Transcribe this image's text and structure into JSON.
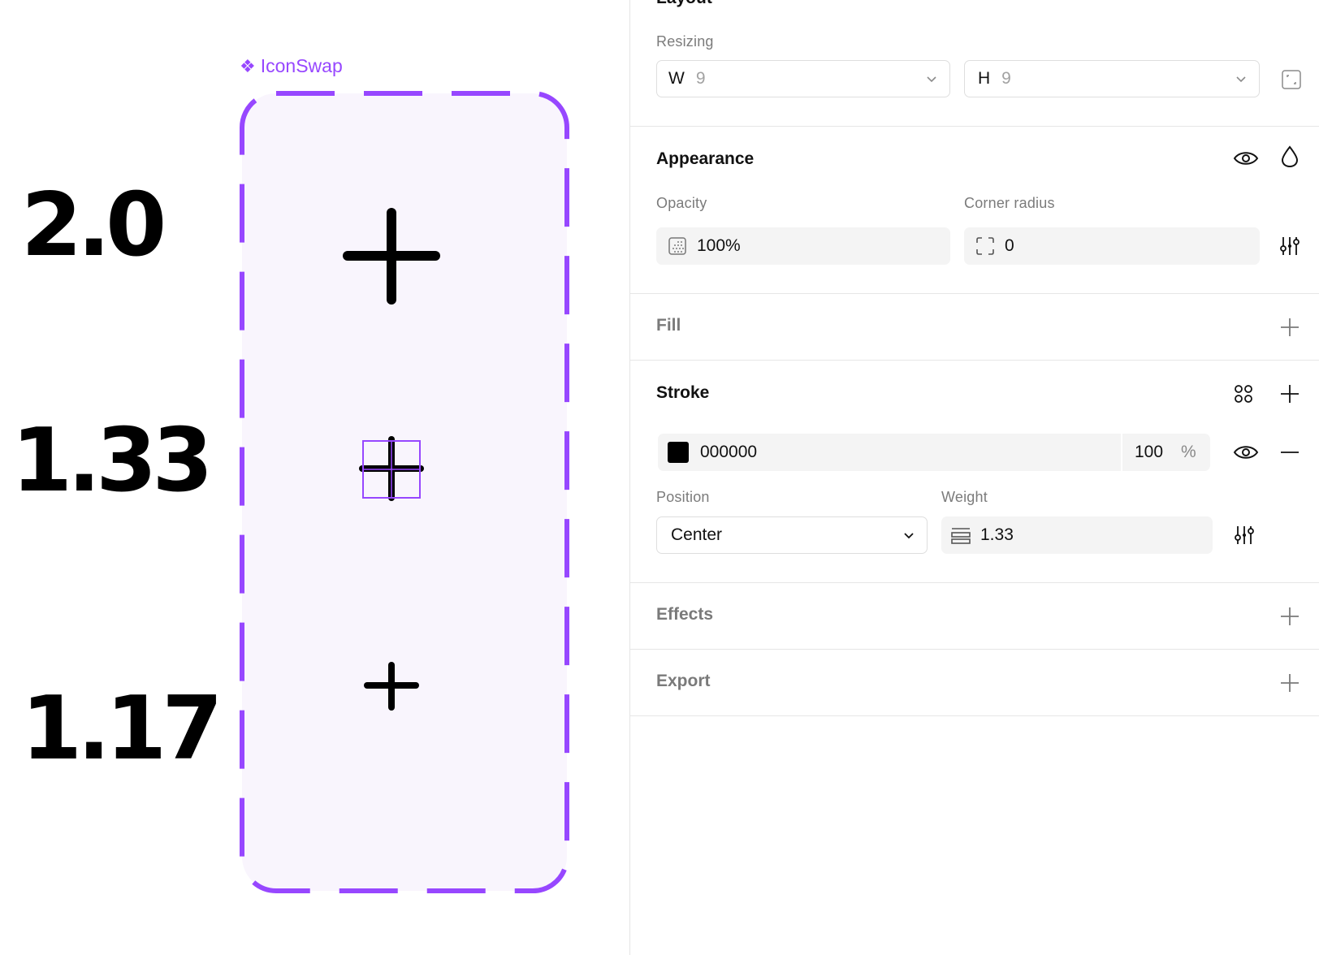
{
  "canvas": {
    "stroke_labels": [
      "2.0",
      "1.33",
      "1.17"
    ],
    "component_name": "IconSwap",
    "component_icon": "component-icon",
    "accent_color": "#9747ff",
    "frame_fill": "#f9f5fd"
  },
  "panel": {
    "layout": {
      "title": "Layout",
      "resizing_label": "Resizing",
      "width": {
        "prefix": "W",
        "value": "9"
      },
      "height": {
        "prefix": "H",
        "value": "9"
      }
    },
    "appearance": {
      "title": "Appearance",
      "opacity_label": "Opacity",
      "opacity_value": "100%",
      "corner_radius_label": "Corner radius",
      "corner_radius_value": "0"
    },
    "fill": {
      "title": "Fill"
    },
    "stroke": {
      "title": "Stroke",
      "color_hex": "000000",
      "swatch_color": "#000000",
      "opacity": "100",
      "opacity_unit": "%",
      "position_label": "Position",
      "position_value": "Center",
      "weight_label": "Weight",
      "weight_value": "1.33"
    },
    "effects": {
      "title": "Effects"
    },
    "export": {
      "title": "Export"
    }
  }
}
